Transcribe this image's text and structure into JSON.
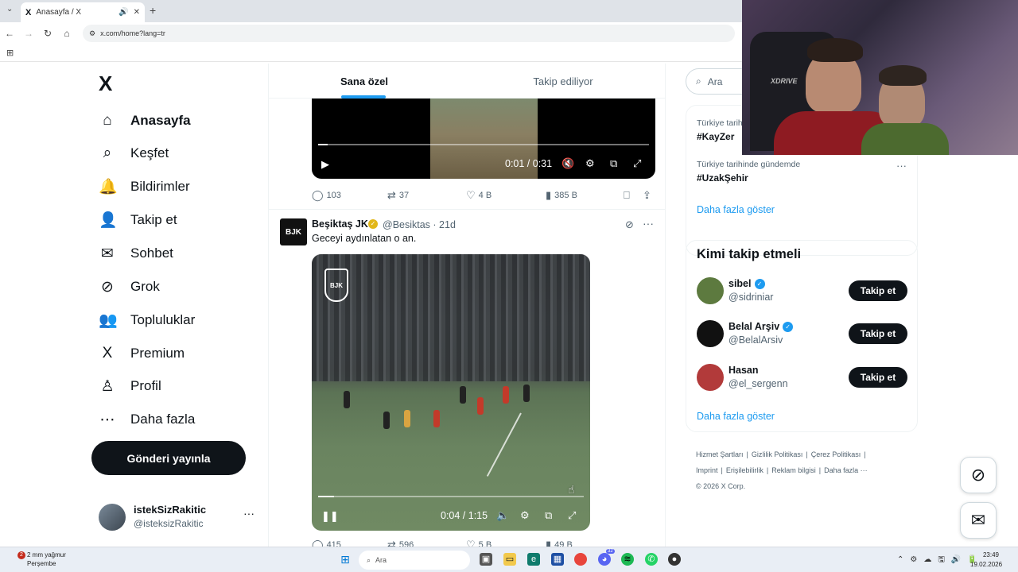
{
  "browser": {
    "tab_title": "Anasayfa / X",
    "tab_x_logo": "X",
    "tab_audio_icon": "speaker-icon",
    "url": "x.com/home?lang=tr"
  },
  "nav": {
    "logo": "X",
    "items": [
      {
        "label": "Anasayfa",
        "icon": "home-icon",
        "glyph": "⌂",
        "active": true
      },
      {
        "label": "Keşfet",
        "icon": "search-icon",
        "glyph": "⌕"
      },
      {
        "label": "Bildirimler",
        "icon": "bell-icon",
        "glyph": "🔔"
      },
      {
        "label": "Takip et",
        "icon": "follow-icon",
        "glyph": "👤"
      },
      {
        "label": "Sohbet",
        "icon": "mail-icon",
        "glyph": "✉"
      },
      {
        "label": "Grok",
        "icon": "grok-icon",
        "glyph": "⊘"
      },
      {
        "label": "Topluluklar",
        "icon": "communities-icon",
        "glyph": "👥"
      },
      {
        "label": "Premium",
        "icon": "x-premium-icon",
        "glyph": "X"
      },
      {
        "label": "Profil",
        "icon": "profile-icon",
        "glyph": "♙"
      },
      {
        "label": "Daha fazla",
        "icon": "more-circle-icon",
        "glyph": "⋯"
      }
    ],
    "post_button": "Gönderi yayınla",
    "account_name": "istekSizRakitic",
    "account_handle": "@isteksizRakitic"
  },
  "feed": {
    "tabs": [
      "Sana özel",
      "Takip ediliyor"
    ],
    "video1": {
      "time": "0:01 / 0:31",
      "progress": 0.03
    },
    "tweet1_actions": {
      "replies": "103",
      "reposts": "37",
      "likes": "4 B",
      "views": "385 B"
    },
    "tweet2": {
      "author": "Beşiktaş JK",
      "handle_time": "@Besiktas · 21d",
      "text": "Geceyi aydınlatan o an.",
      "avatar_text": "BJK",
      "video_time": "0:04 / 1:15",
      "video_progress": 0.06,
      "logo_text": "BJK"
    },
    "tweet2_actions": {
      "replies": "415",
      "reposts": "596",
      "likes": "5 B",
      "views": "49 B"
    }
  },
  "sidebar": {
    "search_placeholder": "Ara",
    "trends": [
      {
        "context": "Türkiye tarihinde gündemde",
        "name": "#KayZer"
      },
      {
        "context": "Türkiye tarihinde gündemde",
        "name": "#UzakŞehir"
      }
    ],
    "trends_show_more": "Daha fazla göster",
    "who_to_follow_title": "Kimi takip etmeli",
    "suggestions": [
      {
        "name": "sibel",
        "handle": "@sidriniar",
        "verified": true,
        "button": "Takip et",
        "color": "#5d7a3f"
      },
      {
        "name": "Belal Arşiv",
        "handle": "@BelalArsiv",
        "verified": true,
        "button": "Takip et",
        "color": "#111111"
      },
      {
        "name": "Hasan",
        "handle": "@el_sergenn",
        "verified": false,
        "button": "Takip et",
        "color": "#b23a3a"
      }
    ],
    "wtf_show_more": "Daha fazla göster",
    "footer": [
      "Hizmet Şartları",
      "|",
      "Gizlilik Politikası",
      "|",
      "Çerez Politikası",
      "|",
      "Imprint",
      "|",
      "Erişilebilirlik",
      "|",
      "Reklam bilgisi",
      "|",
      "Daha fazla ···",
      "© 2026 X Corp."
    ]
  },
  "taskbar": {
    "weather_temp": "2 mm yağmur",
    "weather_day": "Perşembe",
    "weather_badge": "2",
    "search": "Ara",
    "time": "23:49",
    "date": "19.02.2026",
    "discord_badge": "32"
  },
  "webcam": {
    "brand_text": "XDRIVE"
  },
  "colors": {
    "accent": "#1d9bf0",
    "dark": "#0f1419",
    "muted": "#536471"
  }
}
